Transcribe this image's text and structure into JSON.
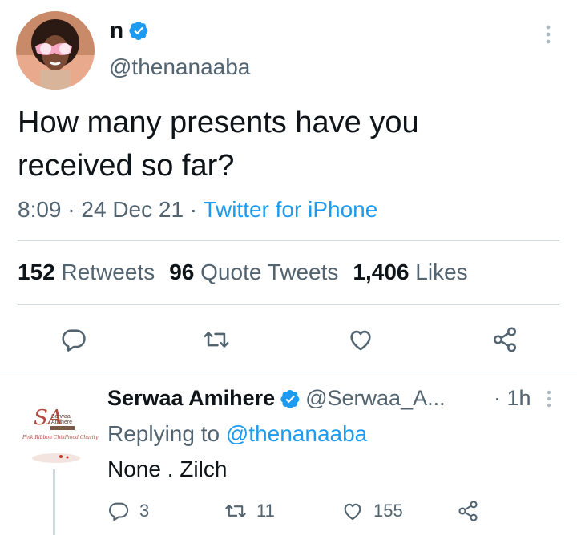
{
  "tweet": {
    "author_name": "n",
    "author_handle": "@thenanaaba",
    "text_line1": "How many presents have you",
    "text_line2": "received so far?",
    "time": "8:09",
    "date": "24 Dec 21",
    "sep": " · ",
    "source": "Twitter for iPhone",
    "stats": {
      "retweets_count": "152",
      "retweets_label": "Retweets",
      "quotes_count": "96",
      "quotes_label": "Quote Tweets",
      "likes_count": "1,406",
      "likes_label": "Likes"
    }
  },
  "reply": {
    "author_name": "Serwaa Amihere",
    "author_handle": "@Serwaa_A...",
    "time": "· 1h",
    "replying_prefix": "Replying to",
    "replying_to": "@thenanaaba",
    "text": "None . Zilch",
    "reply_count": "3",
    "retweet_count": "11",
    "like_count": "155",
    "avatar_logo_line1": "Serwaa",
    "avatar_logo_line2": "Amihere",
    "avatar_tagline": "Pink Ribbon Childhood Charity"
  },
  "colors": {
    "accent": "#1d9bf0",
    "text_primary": "#0f1419",
    "text_secondary": "#536471",
    "divider": "#cfd9de"
  },
  "icons": [
    "verified-badge-icon",
    "more-options-icon",
    "reply-icon",
    "retweet-icon",
    "like-icon",
    "share-icon"
  ]
}
